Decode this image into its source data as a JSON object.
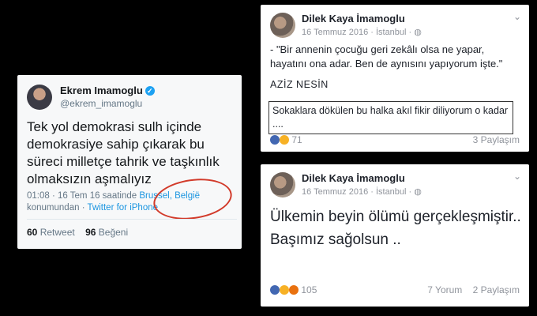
{
  "tweet": {
    "name": "Ekrem Imamoglu",
    "verified_glyph": "✓",
    "handle": "@ekrem_imamoglu",
    "text": "Tek yol demokrasi sulh içinde demokrasiye sahip çıkarak bu süreci milletçe tahrik ve taşkınlık olmaksızın aşmalıyız",
    "time": "01:08 · 16 Tem 16 saatinde",
    "location": "Brussel, België",
    "from_prefix": "konumundan ·",
    "client": "Twitter for iPhone",
    "retweet_count": "60",
    "retweet_label": "Retweet",
    "like_count": "96",
    "like_label": "Beğeni",
    "annotation_color": "#d23a2a"
  },
  "post1": {
    "author": "Dilek Kaya İmamoglu",
    "date": "16 Temmuz 2016 · İstanbul · ◍",
    "menu_glyph": "⌄",
    "quote": "- \"Bir annenin çocuğu geri zekâlı olsa ne yapar, hayatını ona adar. Ben de aynısını yapıyorum işte.\"",
    "quote_author": "AZİZ NESİN",
    "boxed_text": "Sokaklara dökülen bu halka akıl fikir diliyorum o kadar ....",
    "reaction_count": "71",
    "shares": "3 Paylaşım"
  },
  "post2": {
    "author": "Dilek Kaya İmamoglu",
    "date": "16 Temmuz 2016 · İstanbul · ◍",
    "menu_glyph": "⌄",
    "text": "Ülkemin beyin ölümü gerçekleşmiştir.. Başımız sağolsun ..",
    "reaction_count": "105",
    "comments": "7 Yorum",
    "shares": "2 Paylaşım"
  }
}
